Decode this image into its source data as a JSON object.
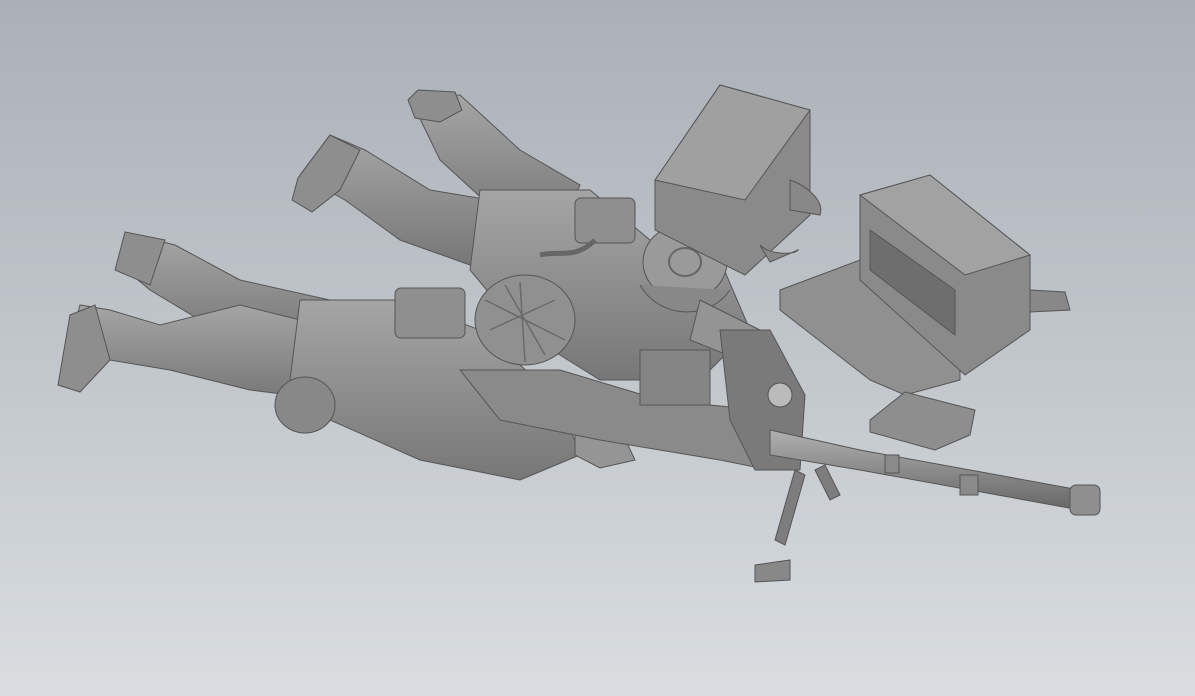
{
  "scene": {
    "subject": "3D model render",
    "colors": {
      "background_top": "#aab0b6",
      "background_bottom": "#d9dde0",
      "model_base": "#8a8a8a",
      "model_light": "#a3a3a3",
      "model_dark": "#5f5f5f"
    },
    "objects": [
      "prone-soldier-loader",
      "prone-soldier-gunner",
      "anti-tank-rifle",
      "bipod",
      "ammo-crate-closed",
      "ammo-crate-open",
      "magazine"
    ]
  }
}
